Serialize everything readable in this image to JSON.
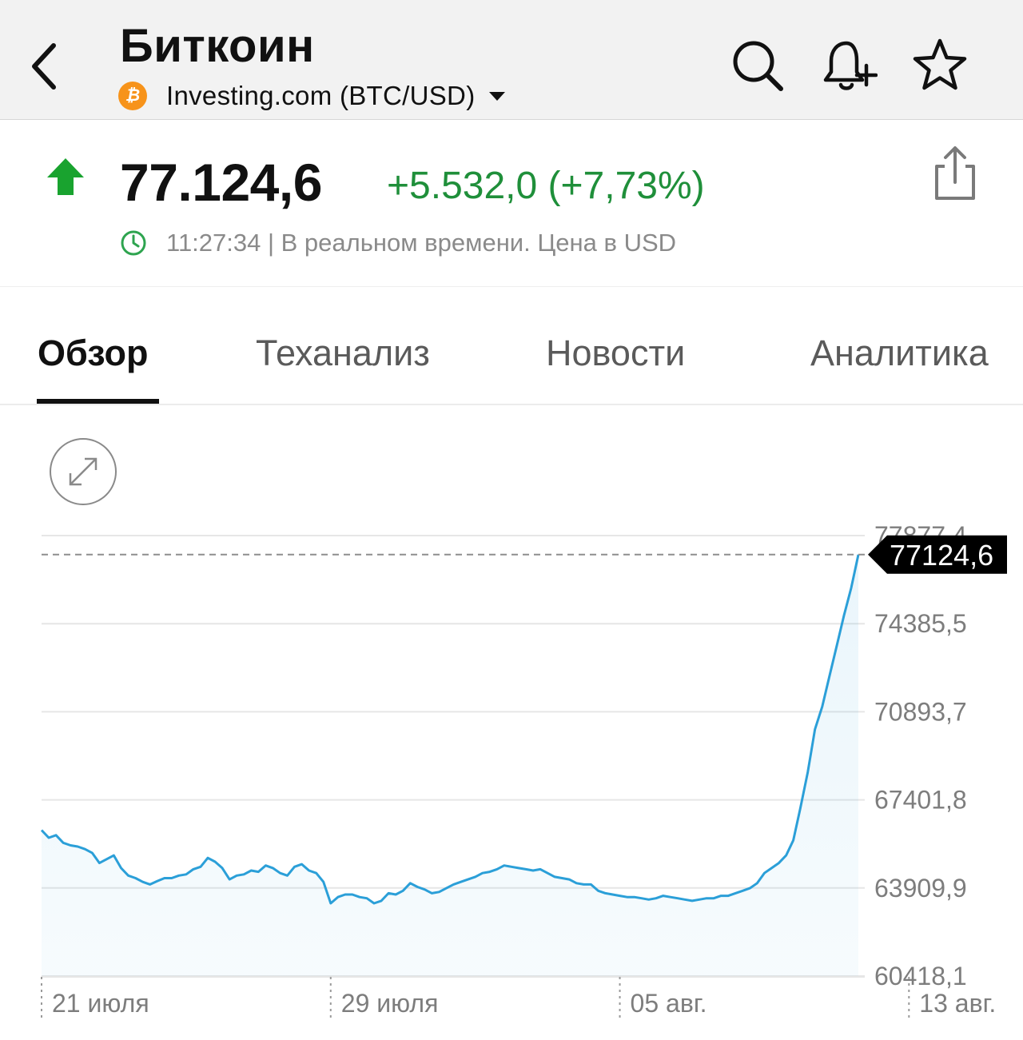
{
  "header": {
    "title": "Биткоин",
    "source": "Investing.com (BTC/USD)",
    "btc_symbol": "₿",
    "icons": [
      "back-chevron-icon",
      "search-icon",
      "bell-plus-icon",
      "star-icon"
    ]
  },
  "quote": {
    "price": "77.124,6",
    "change": "+5.532,0 (+7,73%)",
    "time_text": "11:27:34 | В реальном времени. Цена в USD",
    "colors": {
      "up": "#1f8f3a",
      "arrow": "#19a32f"
    }
  },
  "tabs": [
    {
      "label": "Обзор",
      "active": true
    },
    {
      "label": "Теханализ",
      "active": false
    },
    {
      "label": "Новости",
      "active": false
    },
    {
      "label": "Аналитика",
      "active": false
    }
  ],
  "chart_data": {
    "type": "area",
    "line_color": "#2b9fd8",
    "y_tick_labels": [
      "77877,4",
      "74385,5",
      "70893,7",
      "67401,8",
      "63909,9",
      "60418,1"
    ],
    "y_ticks": [
      77877.4,
      74385.5,
      70893.7,
      67401.8,
      63909.9,
      60418.1
    ],
    "ylim": [
      60418.1,
      77877.4
    ],
    "x_tick_labels": [
      "21 июля",
      "29 июля",
      "05 авг.",
      "13 авг."
    ],
    "x_tick_index": [
      0,
      40,
      80,
      120
    ],
    "last_value_label": "77124,6",
    "last_value": 77124.6,
    "values": [
      66200,
      65900,
      66000,
      65700,
      65600,
      65550,
      65450,
      65300,
      64900,
      65050,
      65200,
      64700,
      64400,
      64300,
      64150,
      64050,
      64180,
      64300,
      64300,
      64400,
      64450,
      64650,
      64750,
      65100,
      64950,
      64700,
      64250,
      64400,
      64450,
      64600,
      64550,
      64800,
      64700,
      64500,
      64400,
      64750,
      64850,
      64600,
      64500,
      64150,
      63300,
      63550,
      63650,
      63650,
      63550,
      63500,
      63300,
      63400,
      63700,
      63650,
      63800,
      64100,
      63950,
      63850,
      63700,
      63750,
      63900,
      64050,
      64150,
      64250,
      64350,
      64500,
      64550,
      64650,
      64800,
      64750,
      64700,
      64650,
      64600,
      64650,
      64500,
      64350,
      64300,
      64250,
      64100,
      64050,
      64050,
      63800,
      63700,
      63650,
      63600,
      63550,
      63550,
      63500,
      63450,
      63500,
      63600,
      63550,
      63500,
      63450,
      63400,
      63450,
      63500,
      63500,
      63600,
      63600,
      63700,
      63800,
      63900,
      64100,
      64500,
      64700,
      64900,
      65200,
      65800,
      67100,
      68500,
      70200,
      71100,
      72300,
      73500,
      74700,
      75800,
      77124.6
    ]
  }
}
